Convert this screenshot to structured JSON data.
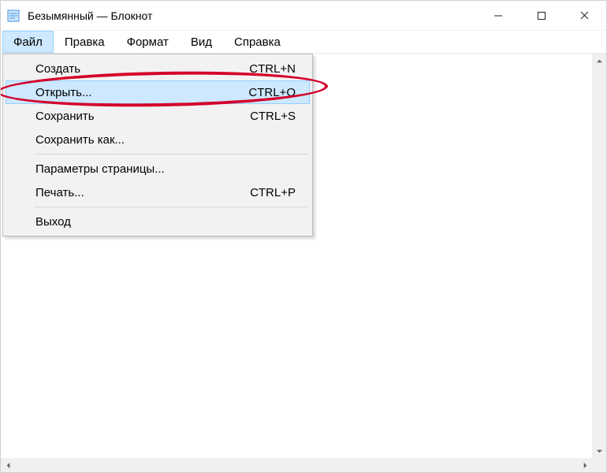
{
  "window": {
    "title": "Безымянный — Блокнот"
  },
  "menubar": {
    "items": [
      {
        "label": "Файл",
        "active": true
      },
      {
        "label": "Правка",
        "active": false
      },
      {
        "label": "Формат",
        "active": false
      },
      {
        "label": "Вид",
        "active": false
      },
      {
        "label": "Справка",
        "active": false
      }
    ]
  },
  "dropdown": {
    "items": [
      {
        "label": "Создать",
        "shortcut": "CTRL+N",
        "highlighted": false
      },
      {
        "label": "Открыть...",
        "shortcut": "CTRL+O",
        "highlighted": true
      },
      {
        "label": "Сохранить",
        "shortcut": "CTRL+S",
        "highlighted": false
      },
      {
        "label": "Сохранить как...",
        "shortcut": "",
        "highlighted": false
      }
    ],
    "items2": [
      {
        "label": "Параметры страницы...",
        "shortcut": "",
        "highlighted": false
      },
      {
        "label": "Печать...",
        "shortcut": "CTRL+P",
        "highlighted": false
      }
    ],
    "items3": [
      {
        "label": "Выход",
        "shortcut": "",
        "highlighted": false
      }
    ]
  },
  "annotation": {
    "color": "#d4002a",
    "target_item_label": "Открыть..."
  }
}
